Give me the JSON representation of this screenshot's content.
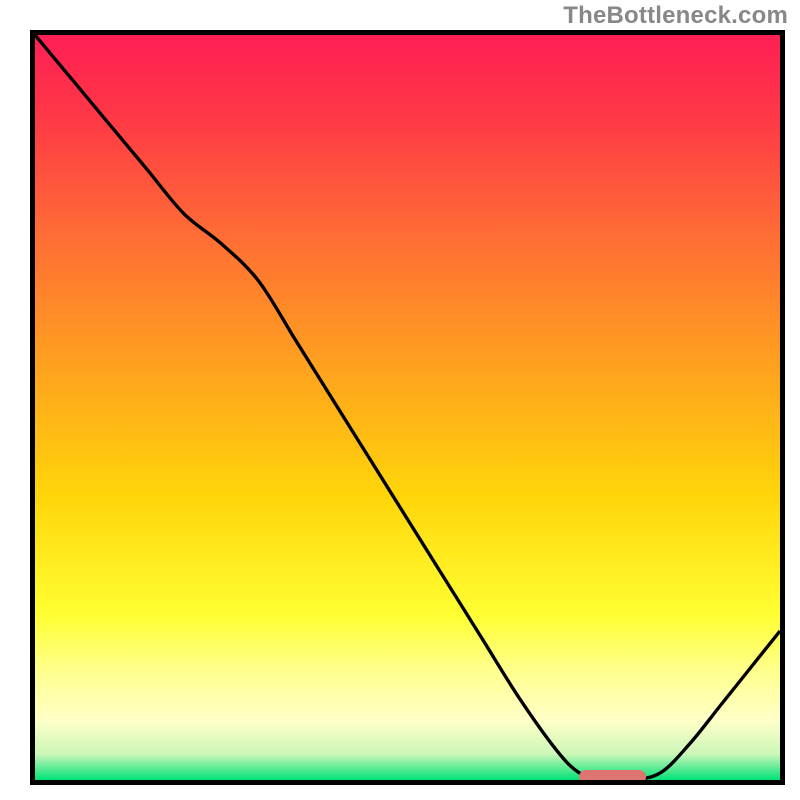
{
  "watermark": "TheBottleneck.com",
  "colors": {
    "border": "#000000",
    "curve": "#000000",
    "marker": "#de7570",
    "gradient_stops": [
      {
        "offset": 0.0,
        "color": "#ff1f55"
      },
      {
        "offset": 0.1,
        "color": "#ff3547"
      },
      {
        "offset": 0.28,
        "color": "#ff7034"
      },
      {
        "offset": 0.45,
        "color": "#ffa31e"
      },
      {
        "offset": 0.62,
        "color": "#ffd60a"
      },
      {
        "offset": 0.78,
        "color": "#ffff33"
      },
      {
        "offset": 0.85,
        "color": "#ffff8a"
      },
      {
        "offset": 0.92,
        "color": "#ffffc8"
      },
      {
        "offset": 0.965,
        "color": "#ccf7b8"
      },
      {
        "offset": 1.0,
        "color": "#00e277"
      }
    ]
  },
  "chart_data": {
    "type": "line",
    "title": "",
    "xlabel": "",
    "ylabel": "",
    "xlim": [
      0,
      100
    ],
    "ylim": [
      0,
      100
    ],
    "grid": false,
    "legend": false,
    "series": [
      {
        "name": "bottleneck-curve",
        "x": [
          0,
          5,
          10,
          15,
          20,
          25,
          30,
          35,
          40,
          45,
          50,
          55,
          60,
          65,
          70,
          73,
          76,
          80,
          84,
          88,
          92,
          96,
          100
        ],
        "y": [
          100,
          94,
          88,
          82,
          76,
          72,
          67,
          59,
          51,
          43,
          35,
          27,
          19,
          11,
          4,
          1,
          0,
          0,
          1,
          5,
          10,
          15,
          20
        ]
      }
    ],
    "marker": {
      "x_start": 73,
      "x_end": 82,
      "y": 0,
      "note": "optimal-range"
    },
    "background": "vertical red→yellow→green gradient (score heatmap)"
  }
}
